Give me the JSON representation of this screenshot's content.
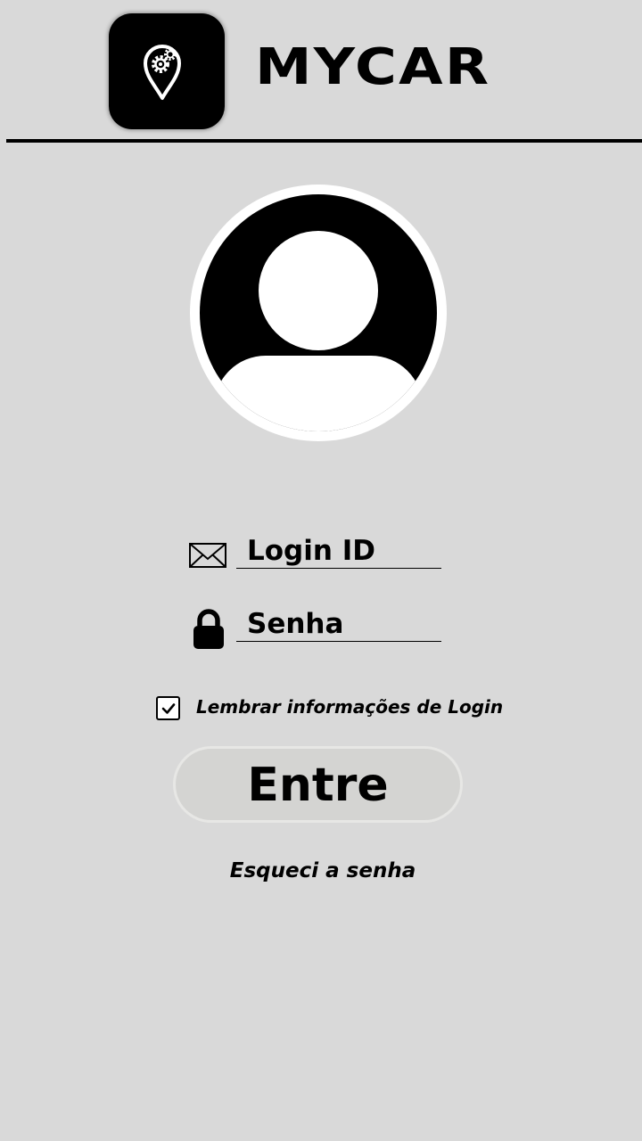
{
  "header": {
    "app_title": "MYCAR",
    "logo_icon": "map-pin-gear-icon"
  },
  "avatar": {
    "icon": "user-avatar-icon"
  },
  "login_form": {
    "login_field": {
      "icon": "envelope-icon",
      "value": "Login ID"
    },
    "password_field": {
      "icon": "lock-icon",
      "value": "Senha"
    },
    "remember": {
      "checked": true,
      "label": "Lembrar informações de Login"
    },
    "submit_label": "Entre",
    "forgot_label": "Esqueci a senha"
  },
  "colors": {
    "background": "#d9d9d9",
    "primary": "#000000",
    "button_fill": "#d4d4d2",
    "button_border": "#e7e7e5",
    "avatar_ring": "#ffffff"
  }
}
